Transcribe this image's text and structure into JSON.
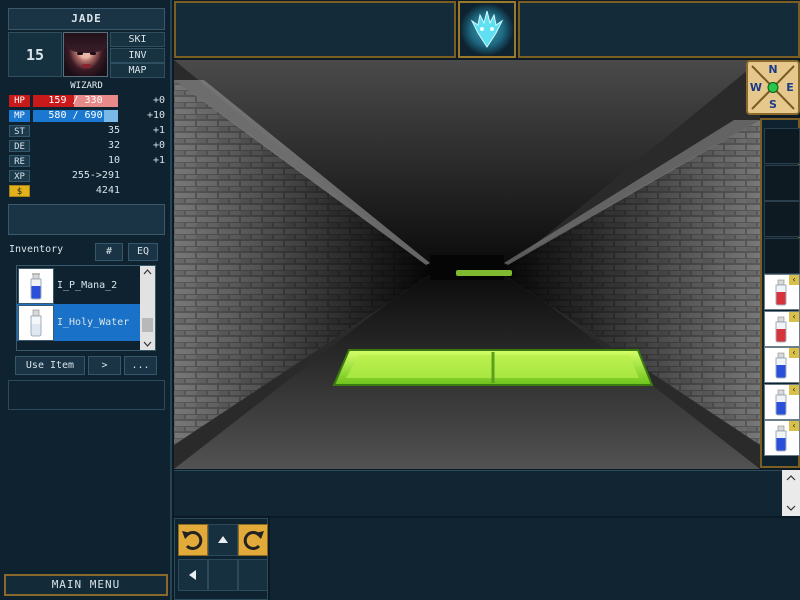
{
  "character": {
    "name": "JADE",
    "level": "15",
    "class": "WIZARD",
    "tabs": [
      "SKI",
      "INV",
      "MAP"
    ]
  },
  "vitals": {
    "hp": {
      "tag": "HP",
      "text": "159 / 330",
      "current": 159,
      "max": 330,
      "bonus": "+0",
      "color": "#c81a1a"
    },
    "mp": {
      "tag": "MP",
      "text": "580 / 690",
      "current": 580,
      "max": 690,
      "bonus": "+10",
      "color": "#1a78d0"
    }
  },
  "stats": [
    {
      "tag": "ST",
      "value": "35",
      "bonus": "+1"
    },
    {
      "tag": "DE",
      "value": "32",
      "bonus": "+0"
    },
    {
      "tag": "RE",
      "value": "10",
      "bonus": "+1"
    },
    {
      "tag": "XP",
      "value": "255->291",
      "bonus": ""
    },
    {
      "tag": "$",
      "value": "4241",
      "bonus": ""
    }
  ],
  "inventory": {
    "title": "Inventory",
    "hash_label": "#",
    "eq_label": "EQ",
    "items": [
      {
        "name": "I_P_Mana_2",
        "icon": "blue-potion-icon",
        "selected": false
      },
      {
        "name": "I_Holy_Water",
        "icon": "holy-water-icon",
        "selected": true
      }
    ],
    "use_label": "Use Item",
    "next_label": ">",
    "more_label": "..."
  },
  "main_menu_label": "MAIN MENU",
  "compass": {
    "n": "N",
    "s": "S",
    "e": "E",
    "w": "W"
  },
  "quickbar": [
    {
      "filled": false
    },
    {
      "filled": false
    },
    {
      "filled": false
    },
    {
      "filled": false
    },
    {
      "filled": true,
      "icon": "red-potion-icon",
      "color": "#d8333a"
    },
    {
      "filled": true,
      "icon": "red-potion-icon",
      "color": "#d8333a"
    },
    {
      "filled": true,
      "icon": "blue-potion-icon",
      "color": "#2a4fd8"
    },
    {
      "filled": true,
      "icon": "blue-potion-icon",
      "color": "#2a4fd8"
    },
    {
      "filled": true,
      "icon": "blue-potion-icon",
      "color": "#2a4fd8"
    }
  ],
  "colors": {
    "accent_gold": "#e2aa3a",
    "acid": "#9ee63a",
    "selected_row": "#1a72c8"
  }
}
